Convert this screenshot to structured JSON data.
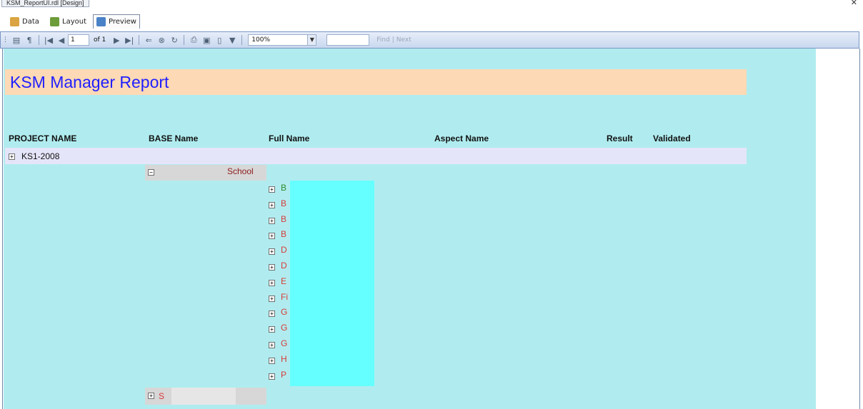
{
  "document_tab": {
    "title": "KSM_ReportUI.rdl [Design]"
  },
  "view_tabs": [
    {
      "label": "Data",
      "active": false
    },
    {
      "label": "Layout",
      "active": false
    },
    {
      "label": "Preview",
      "active": true
    }
  ],
  "toolbar": {
    "page_number": "1",
    "page_of": "of 1",
    "zoom": "100%",
    "find": "Find",
    "next": "Next"
  },
  "report": {
    "title": "KSM Manager Report",
    "columns": [
      "PROJECT NAME",
      "BASE Name",
      "Full Name",
      "Aspect Name",
      "Result",
      "Validated"
    ],
    "project": "KS1-2008",
    "base_name": "School",
    "full_name_rows": [
      {
        "text": "B",
        "color": "green"
      },
      {
        "text": "B",
        "color": "red"
      },
      {
        "text": "B",
        "color": "red"
      },
      {
        "text": "B",
        "color": "red"
      },
      {
        "text": "D",
        "color": "red"
      },
      {
        "text": "D",
        "color": "red"
      },
      {
        "text": "E",
        "color": "red"
      },
      {
        "text": "Fi",
        "color": "red"
      },
      {
        "text": "G",
        "color": "red"
      },
      {
        "text": "G",
        "color": "red"
      },
      {
        "text": "G",
        "color": "red"
      },
      {
        "text": "H",
        "color": "red"
      },
      {
        "text": "P",
        "color": "red"
      }
    ],
    "next_base": "S"
  },
  "colors": {
    "canvas": "#b0ecef",
    "title_band": "#fdd9b5",
    "title_text": "#2020ff",
    "project_row": "#e5e5fa",
    "highlight": "#66ffff"
  }
}
